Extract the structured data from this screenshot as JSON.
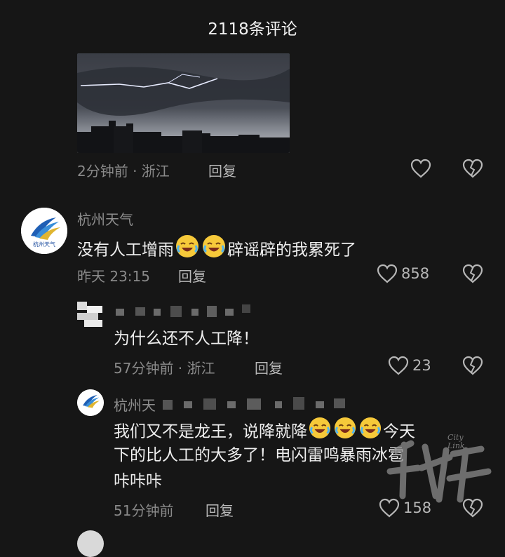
{
  "header": {
    "title": "2118条评论"
  },
  "comment_top": {
    "time_location": "2分钟前 · 浙江",
    "reply_label": "回复"
  },
  "comment_main": {
    "author": "杭州天气",
    "avatar_text": "杭州天气",
    "text_before": "没有人工增雨",
    "text_after": "辟谣辟的我累死了",
    "time": "昨天 23:15",
    "reply_label": "回复",
    "like_count": "858"
  },
  "reply_1": {
    "text": "为什么还不人工降！",
    "time_location": "57分钟前 · 浙江",
    "reply_label": "回复",
    "like_count": "23"
  },
  "reply_2": {
    "author": "杭州天",
    "text_line1_before": "我们又不是龙王，说降就降",
    "text_line1_after": "今天",
    "text_line2": "下的比人工的大多了！电闪雷鸣暴雨冰雹",
    "text_line3": "咔咔咔",
    "time": "51分钟前",
    "reply_label": "回复",
    "like_count": "158"
  },
  "watermark": {
    "text": "City Link"
  }
}
